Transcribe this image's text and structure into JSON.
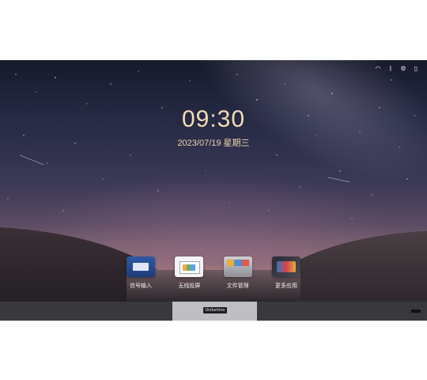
{
  "status_bar": {
    "icons": [
      "wifi-icon",
      "bluetooth-icon",
      "settings-icon",
      "file-icon"
    ]
  },
  "clock": {
    "time": "09:30",
    "date": "2023/07/19 星期三"
  },
  "dock": {
    "apps": [
      {
        "label": "信号输入",
        "icon": "signal-input-icon"
      },
      {
        "label": "无线投屏",
        "icon": "wireless-cast-icon"
      },
      {
        "label": "文件管理",
        "icon": "file-manager-icon"
      },
      {
        "label": "更多应用",
        "icon": "more-apps-icon"
      }
    ]
  },
  "bottom": {
    "brand": "Uniluminv"
  },
  "colors": {
    "clock_text": "#f4ddb6",
    "sky_top": "#171a2c",
    "sky_glow": "#d9a070"
  }
}
